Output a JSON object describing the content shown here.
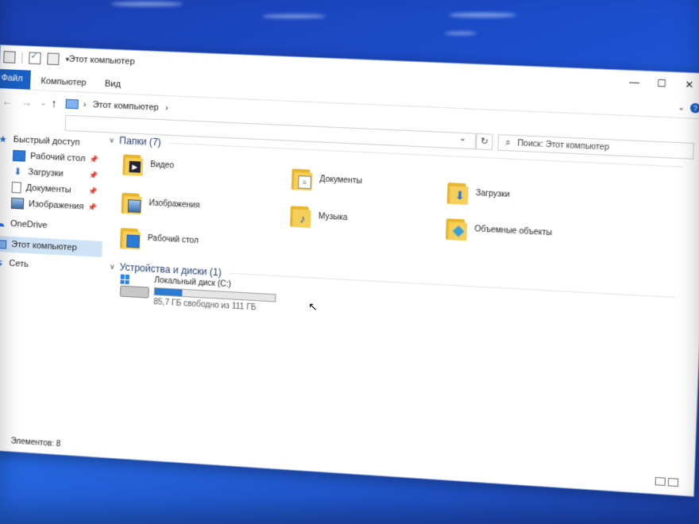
{
  "window": {
    "title": "Этот компьютер",
    "controls": [
      "—",
      "☐",
      "✕"
    ]
  },
  "ribbon": {
    "tabs": [
      "Файл",
      "Компьютер",
      "Вид"
    ]
  },
  "nav_buttons": {
    "back": "←",
    "forward": "→",
    "dropdown": "⌄",
    "up": "↑"
  },
  "address": {
    "segments": [
      "Этот компьютер"
    ],
    "separator": "›",
    "refresh": "↻"
  },
  "search": {
    "placeholder": "Поиск: Этот компьютер"
  },
  "sidebar": {
    "items": [
      {
        "label": "Быстрый доступ",
        "icon": "star-icon"
      },
      {
        "label": "Рабочий стол",
        "icon": "desktop-icon",
        "pinned": true
      },
      {
        "label": "Загрузки",
        "icon": "download-icon",
        "pinned": true
      },
      {
        "label": "Документы",
        "icon": "document-icon",
        "pinned": true
      },
      {
        "label": "Изображения",
        "icon": "image-icon",
        "pinned": true
      },
      {
        "label": "OneDrive",
        "icon": "cloud-icon"
      },
      {
        "label": "Этот компьютер",
        "icon": "pc-icon",
        "selected": true
      },
      {
        "label": "Сеть",
        "icon": "network-icon"
      }
    ]
  },
  "folders_group": {
    "title": "Папки (7)",
    "items": [
      {
        "label": "Видео",
        "icon": "video-folder-icon"
      },
      {
        "label": "Документы",
        "icon": "documents-folder-icon"
      },
      {
        "label": "Загрузки",
        "icon": "downloads-folder-icon"
      },
      {
        "label": "Изображения",
        "icon": "pictures-folder-icon"
      },
      {
        "label": "Музыка",
        "icon": "music-folder-icon"
      },
      {
        "label": "Объемные объекты",
        "icon": "3d-objects-folder-icon"
      },
      {
        "label": "Рабочий стол",
        "icon": "desktop-folder-icon"
      }
    ]
  },
  "devices_group": {
    "title": "Устройства и диски (1)",
    "drive": {
      "label": "Локальный диск (C:)",
      "free_text": "85,7 ГБ свободно из 111 ГБ",
      "used_fraction": 0.23
    }
  },
  "status": {
    "items_text": "Элементов: 8"
  },
  "colors": {
    "accent": "#1a5fc4",
    "folder": "#f5cf5a",
    "progress": "#2b7bd6",
    "desktop": "#1d4fd0"
  }
}
